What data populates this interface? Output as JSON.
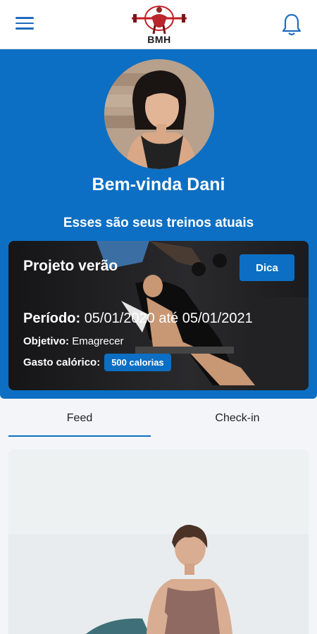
{
  "header": {
    "logo_text": "BMH",
    "menu_icon": "hamburger-menu-icon",
    "notification_icon": "bell-icon"
  },
  "hero": {
    "welcome": "Bem-vinda Dani",
    "subtitle": "Esses são seus treinos atuais"
  },
  "workout": {
    "title": "Projeto verão",
    "tip_button": "Dica",
    "period_label": "Período:",
    "period_value": "05/01/2020 até 05/01/2021",
    "goal_label": "Objetivo:",
    "goal_value": "Emagrecer",
    "calories_label": "Gasto calórico:",
    "calories_value": "500 calorias"
  },
  "tabs": {
    "feed": "Feed",
    "checkin": "Check-in",
    "active": "Feed"
  },
  "colors": {
    "primary": "#0c6fc3",
    "card_dark": "#1c1c1e",
    "background": "#f3f5f8"
  }
}
